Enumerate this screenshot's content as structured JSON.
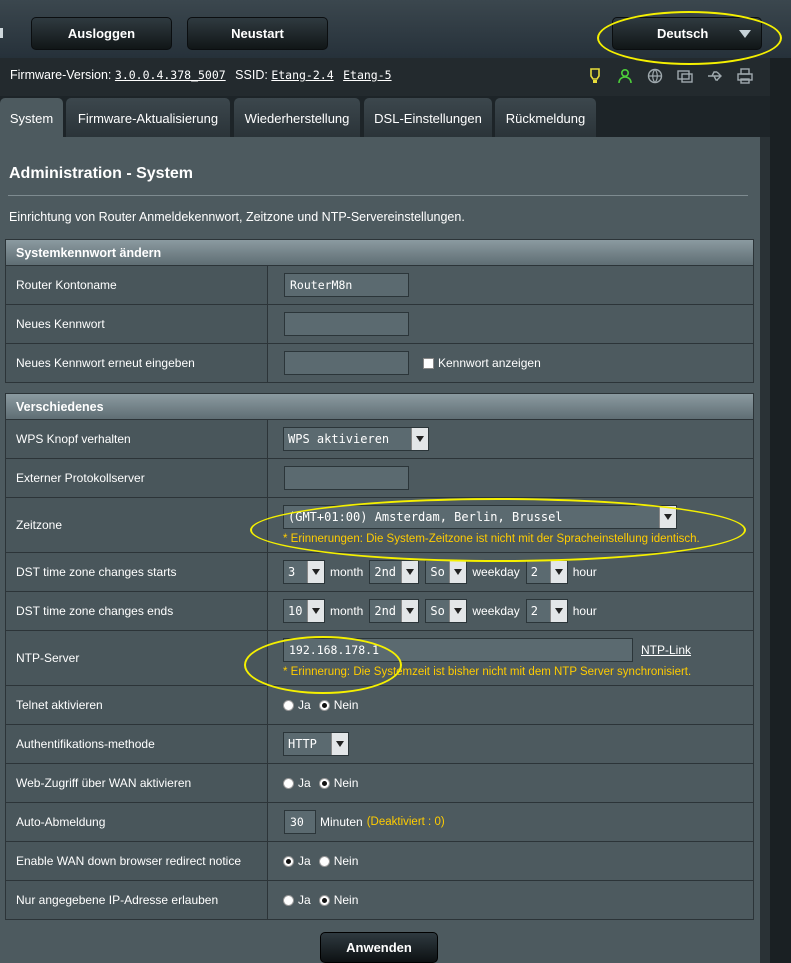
{
  "header": {
    "logout_label": "Ausloggen",
    "reboot_label": "Neustart",
    "language": "Deutsch"
  },
  "info": {
    "firmware_label": "Firmware-Version:",
    "firmware_value": "3.0.0.4.378_5007",
    "ssid_label": "SSID:",
    "ssid_1": "Etang-2.4",
    "ssid_2": "Etang-5"
  },
  "tabs": [
    {
      "label": "System"
    },
    {
      "label": "Firmware-Aktualisierung"
    },
    {
      "label": "Wiederherstellung"
    },
    {
      "label": "DSL-Einstellungen"
    },
    {
      "label": "Rückmeldung"
    }
  ],
  "page": {
    "title": "Administration - System",
    "description": "Einrichtung von Router Anmeldekennwort, Zeitzone und NTP-Servereinstellungen."
  },
  "sections": {
    "password": {
      "header": "Systemkennwort ändern",
      "account_label": "Router Kontoname",
      "account_value": "RouterM8n",
      "new_pw_label": "Neues Kennwort",
      "confirm_pw_label": "Neues Kennwort erneut eingeben",
      "show_pw_label": "Kennwort anzeigen"
    },
    "misc": {
      "header": "Verschiedenes",
      "wps_label": "WPS Knopf verhalten",
      "wps_value": "WPS aktivieren",
      "syslog_label": "Externer Protokollserver",
      "tz_label": "Zeitzone",
      "tz_value": "(GMT+01:00) Amsterdam, Berlin, Brussel",
      "tz_warning": "* Erinnerungen: Die System-Zeitzone ist nicht mit der Spracheinstellung identisch.",
      "dst_start_label": "DST time zone changes starts",
      "dst_end_label": "DST time zone changes ends",
      "dst_start": {
        "month": "3",
        "week": "2nd",
        "day": "So",
        "hour": "2"
      },
      "dst_end": {
        "month": "10",
        "week": "2nd",
        "day": "So",
        "hour": "2"
      },
      "month_word": "month",
      "weekday_word": "weekday",
      "hour_word": "hour",
      "ntp_label": "NTP-Server",
      "ntp_value": "192.168.178.1",
      "ntp_link": "NTP-Link",
      "ntp_warning": "* Erinnerung: Die Systemzeit ist bisher nicht mit dem NTP Server synchronisiert.",
      "telnet_label": "Telnet aktivieren",
      "auth_label": "Authentifikations-methode",
      "auth_value": "HTTP",
      "wan_access_label": "Web-Zugriff über WAN aktivieren",
      "auto_logout_label": "Auto-Abmeldung",
      "auto_logout_value": "30",
      "minutes_word": "Minuten",
      "deactivated_note": "(Deaktiviert : 0)",
      "wan_redirect_label": "Enable WAN down browser redirect notice",
      "ip_restrict_label": "Nur angegebene IP-Adresse erlauben",
      "yes": "Ja",
      "no": "Nein"
    }
  },
  "apply_label": "Anwenden",
  "colors": {
    "warning": "#ffcc00",
    "annotation": "#f5f000",
    "panel": "#4d5a5f"
  }
}
